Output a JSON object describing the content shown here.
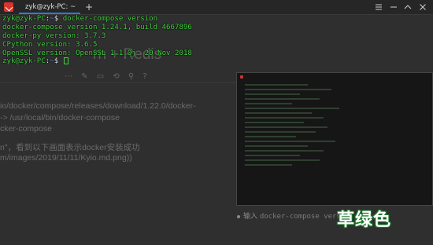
{
  "window": {
    "tab_title": "zyk@zyk-PC: ~",
    "new_tab": "+"
  },
  "background_doc": {
    "title_fragment": "rn + Redis",
    "line1": "io/docker/compose/releases/download/1.22.0/docker-",
    "line2": "-> /usr/local/bin/docker-compose",
    "line3": "cker-compose",
    "line4": "n\"，看到以下画面表示docker安装成功",
    "line5": "m/images/2019/11/11/Kyio.md.png))",
    "toolbar_glyphs": "⋯  ✎  ▭  ⟲  ⚲  ?",
    "bullet_text": "输入",
    "bullet_code": "docker-compose versio"
  },
  "terminal": {
    "prompt_user": "zyk@zyk-PC",
    "prompt_path": "~",
    "prompt_symbol": "$",
    "command": "docker-compose version",
    "output": [
      "docker-compose version 1.24.1, build 4667896",
      "docker-py version: 3.7.3",
      "CPython version: 3.6.5",
      "OpenSSL version: OpenSSL 1.1.0j  20 Nov 2018"
    ]
  },
  "watermark": "草绿色"
}
